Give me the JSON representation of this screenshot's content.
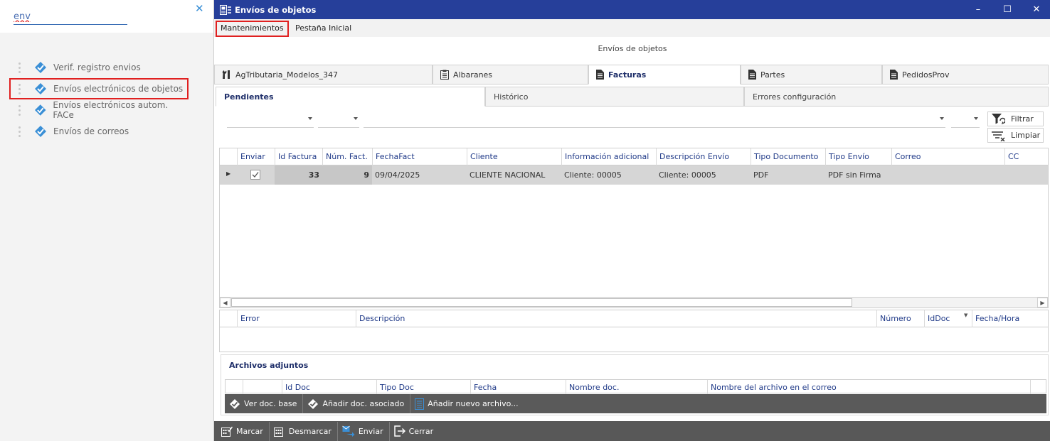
{
  "search": {
    "value": "env",
    "clear_icon": "close-icon"
  },
  "nav": {
    "items": [
      {
        "label": "Verif. registro envios",
        "icon": "module-icon"
      },
      {
        "label": "Envíos electrónicos de objetos",
        "icon": "module-icon",
        "selected": true
      },
      {
        "label": "Envíos electrónicos autom. FACe",
        "icon": "module-icon"
      },
      {
        "label": "Envíos de correos",
        "icon": "module-icon"
      }
    ]
  },
  "window": {
    "title": "Envíos de objetos",
    "minimize": "–",
    "maximize": "☐",
    "close": "✕"
  },
  "menu": {
    "items": [
      "Mantenimientos",
      "Pestaña Inicial"
    ]
  },
  "form_caption": "Envíos de objetos",
  "module_tabs": [
    {
      "label": "AgTributaria_Modelos_347",
      "icon": "wrench-icon"
    },
    {
      "label": "Albaranes",
      "icon": "clipboard-icon"
    },
    {
      "label": "Facturas",
      "icon": "document-icon",
      "active": true
    },
    {
      "label": "Partes",
      "icon": "document-icon"
    },
    {
      "label": "PedidosProv",
      "icon": "document-icon"
    }
  ],
  "sub_tabs": [
    {
      "label": "Pendientes",
      "active": true
    },
    {
      "label": "Histórico"
    },
    {
      "label": "Errores configuración"
    }
  ],
  "filters": {
    "filter_label": "Filtrar",
    "clear_label": "Limpiar"
  },
  "main_grid": {
    "columns": [
      "Enviar",
      "Id Factura",
      "Núm. Fact.",
      "FechaFact",
      "Cliente",
      "Información adicional",
      "Descripción Envío",
      "Tipo Documento",
      "Tipo Envío",
      "Correo",
      "CC"
    ],
    "rows": [
      {
        "enviar": true,
        "id_factura": "33",
        "num_fact": "9",
        "fecha": "09/04/2025",
        "cliente": "CLIENTE NACIONAL",
        "info": "Cliente: 00005",
        "descripcion": "Cliente: 00005",
        "tipo_doc": "PDF",
        "tipo_envio": "PDF sin Firma",
        "correo": "",
        "cc": ""
      }
    ]
  },
  "error_grid": {
    "columns": [
      "Error",
      "Descripción",
      "Número",
      "IdDoc",
      "Fecha/Hora"
    ]
  },
  "attachments": {
    "title": "Archivos adjuntos",
    "columns": [
      "Id Doc",
      "Tipo Doc",
      "Fecha",
      "Nombre doc.",
      "Nombre del archivo en el correo"
    ],
    "toolbar": [
      "Ver doc. base",
      "Añadir doc. asociado",
      "Añadir nuevo archivo..."
    ]
  },
  "bottom_toolbar": [
    "Marcar",
    "Desmarcar",
    "Enviar",
    "Cerrar"
  ],
  "colors": {
    "titlebar": "#263f9a",
    "highlight": "#e02020",
    "header_text": "#203a88",
    "toolbar": "#585858",
    "icon_blue": "#3a8fd6"
  }
}
